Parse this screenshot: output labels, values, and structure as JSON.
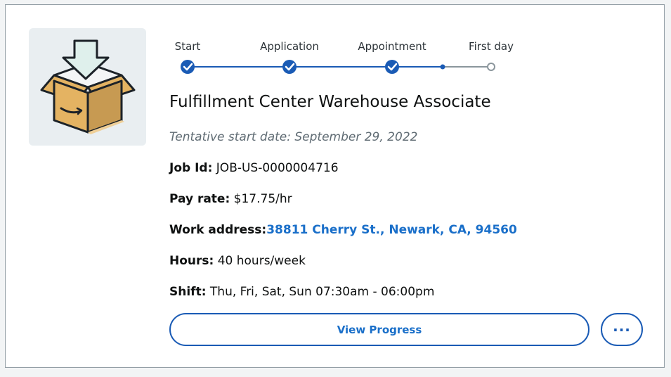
{
  "progress": {
    "steps": [
      {
        "label": "Start",
        "state": "complete"
      },
      {
        "label": "Application",
        "state": "complete"
      },
      {
        "label": "Appointment",
        "state": "complete"
      },
      {
        "label": "First day",
        "state": "pending"
      }
    ]
  },
  "job": {
    "title": "Fulfillment Center Warehouse Associate",
    "tentative_start": "Tentative start date: September 29, 2022",
    "job_id_label": "Job Id:",
    "job_id_value": "JOB-US-0000004716",
    "pay_label": "Pay rate:",
    "pay_value": "$17.75/hr",
    "address_label": "Work address:",
    "address_value": "38811 Cherry St., Newark, CA, 94560",
    "hours_label": "Hours:",
    "hours_value": "40 hours/week",
    "shift_label": "Shift:",
    "shift_value": "Thu, Fri, Sat, Sun 07:30am - 06:00pm"
  },
  "actions": {
    "view_progress_label": "View Progress",
    "more_label": "···"
  },
  "colors": {
    "accent": "#1a5bb5",
    "link": "#1a6fc9",
    "pending": "#8b969c"
  },
  "icons": {
    "thumbnail": "package-download-icon",
    "step_complete": "check-circle-icon",
    "step_pending": "empty-circle-icon"
  }
}
